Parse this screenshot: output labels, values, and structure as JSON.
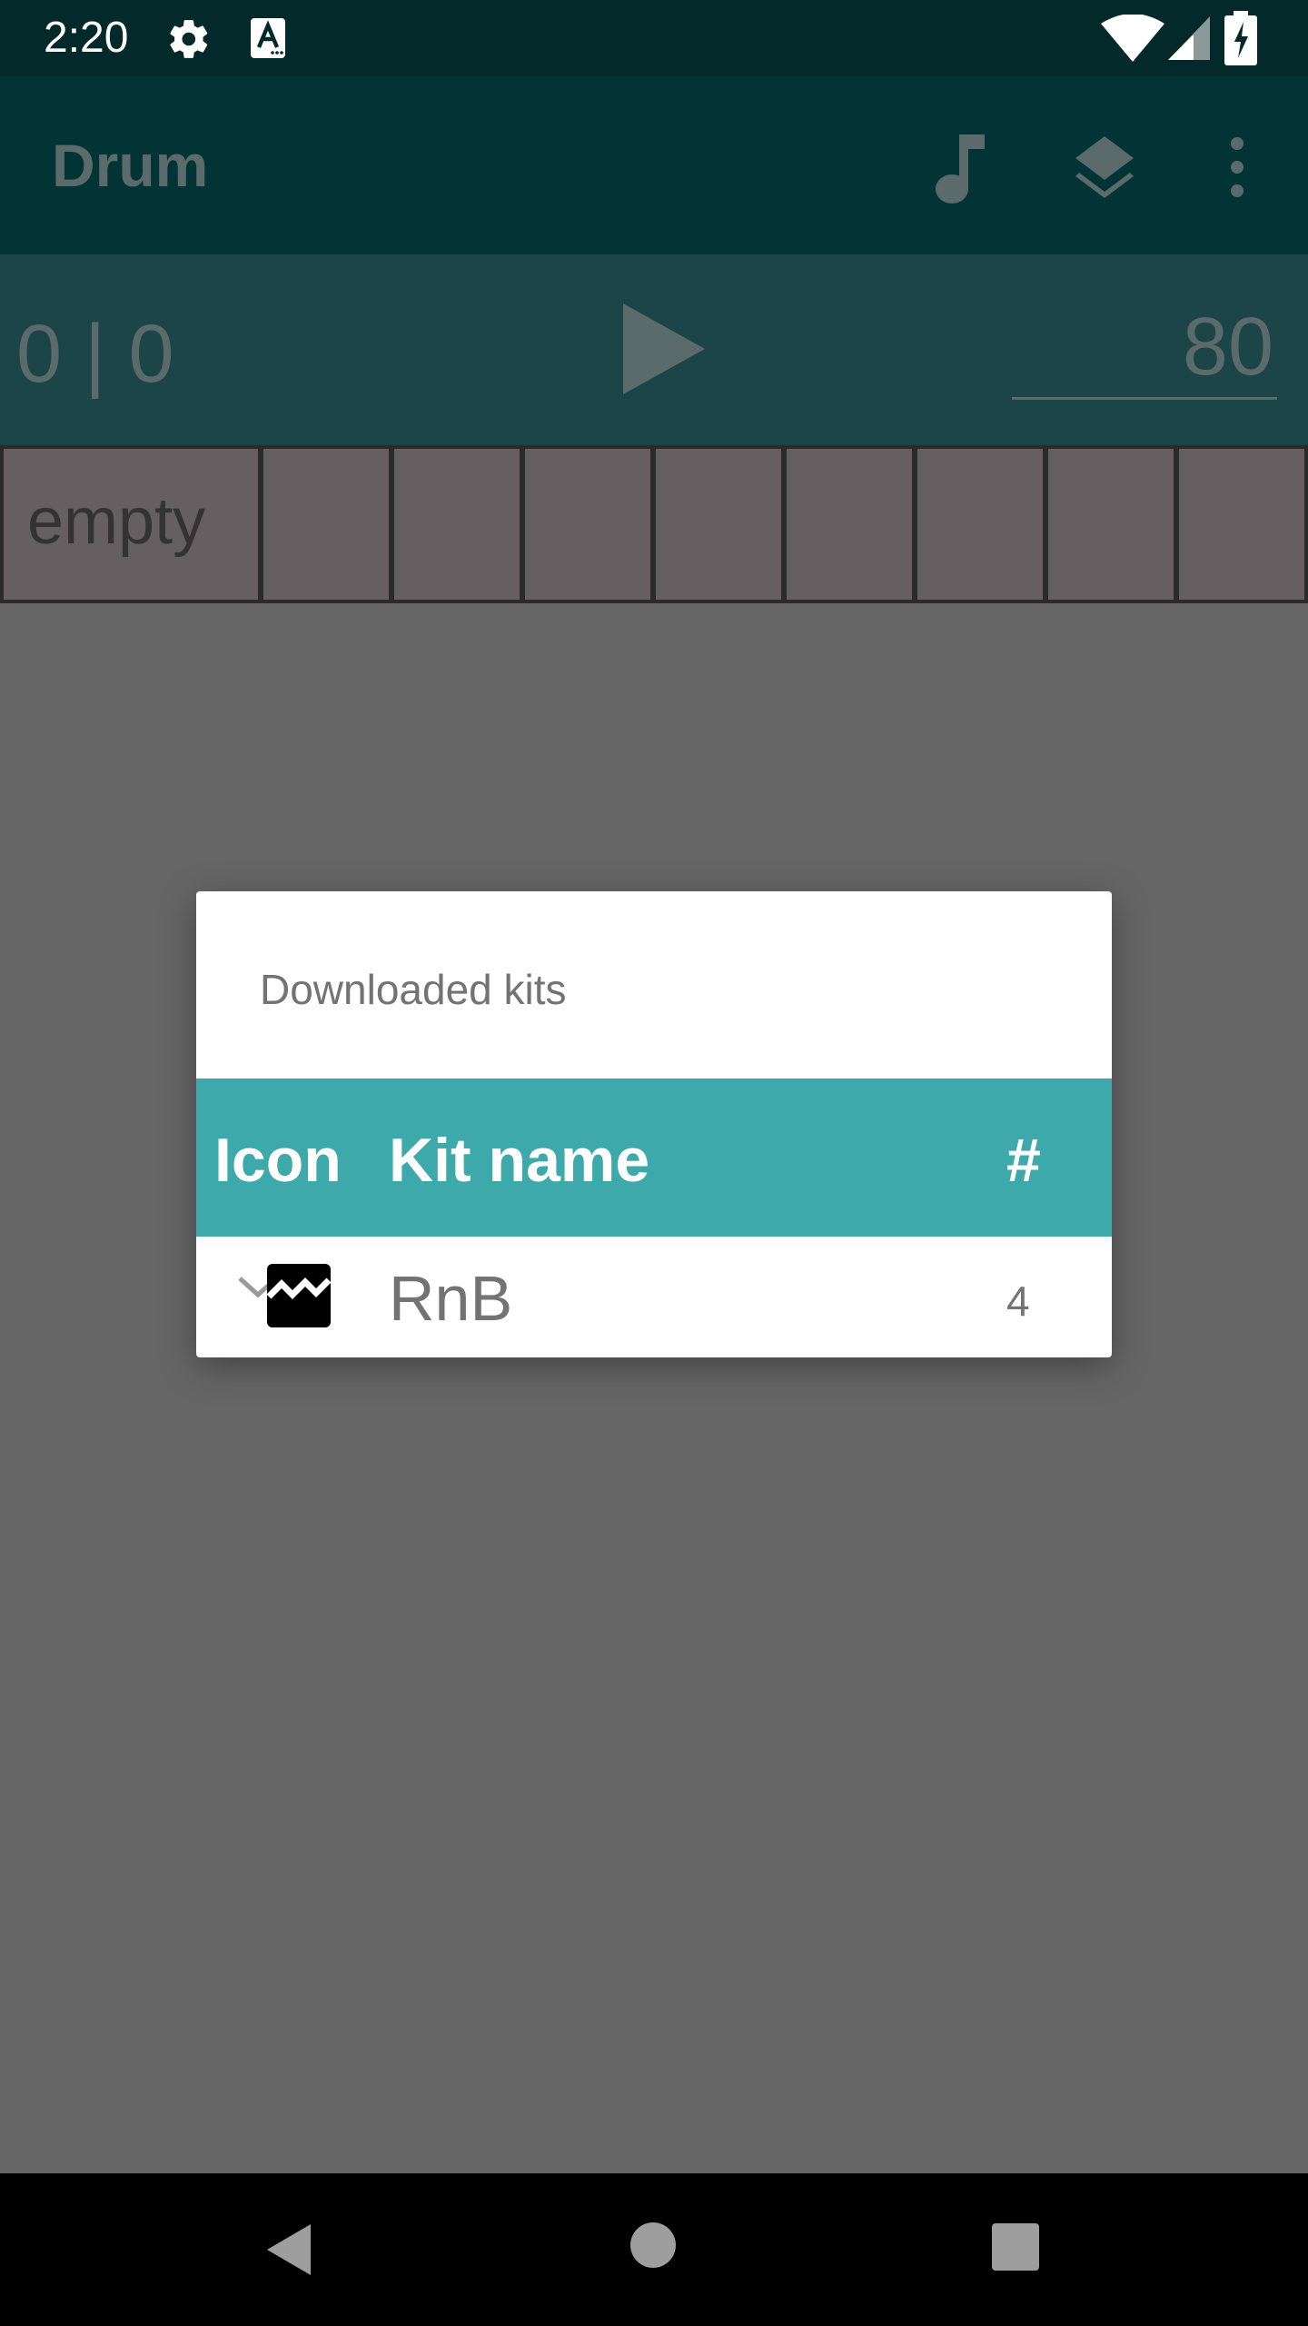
{
  "status_bar": {
    "time": "2:20"
  },
  "app_bar": {
    "title": "Drum"
  },
  "transport": {
    "counter": "0 | 0",
    "tempo": "80"
  },
  "pads": {
    "first_label": "empty"
  },
  "dialog": {
    "title": "Downloaded kits",
    "columns": {
      "icon": "Icon",
      "name": "Kit name",
      "count": "#"
    },
    "rows": [
      {
        "name": "RnB",
        "count": "4"
      }
    ]
  },
  "colors": {
    "status_bar_bg": "#04292b",
    "app_bar_bg": "#023335",
    "transport_bg": "#1b4546",
    "header_accent": "#3ea9aa",
    "scrim": "#666666"
  }
}
